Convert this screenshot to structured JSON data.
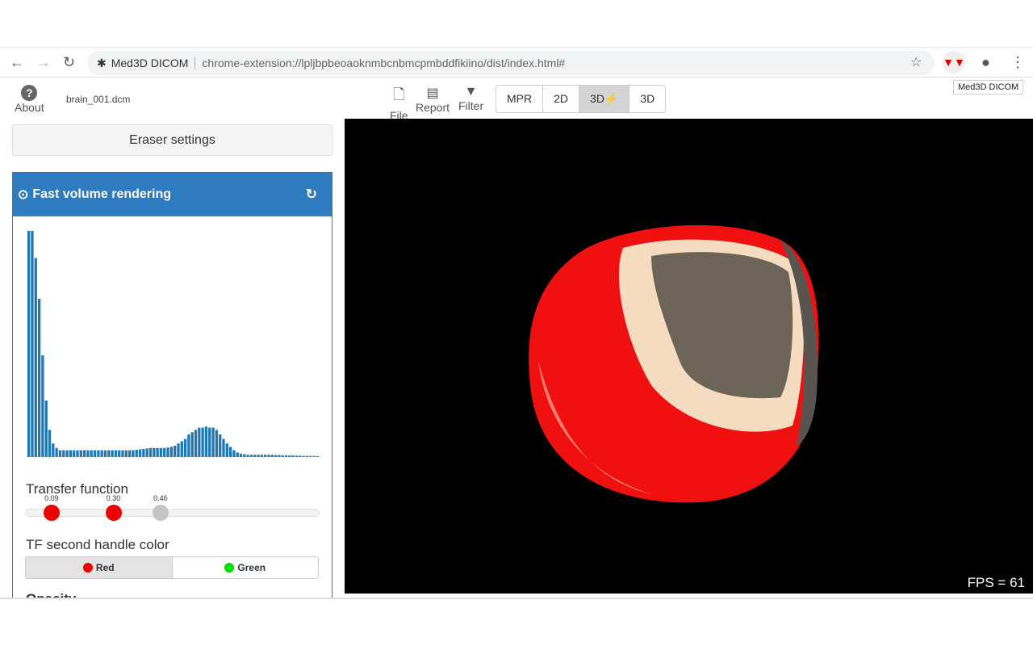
{
  "browser": {
    "site_name": "Med3D DICOM",
    "url": "chrome-extension://lpljbpbeoaoknmbcnbmcpmbddfikiino/dist/index.html#",
    "tooltip": "Med3D DICOM"
  },
  "toolbar": {
    "about": "About",
    "filename": "brain_001.dcm",
    "file": "File",
    "report": "Report",
    "filter": "Filter",
    "modes": [
      "MPR",
      "2D",
      "3D⚡",
      "3D"
    ],
    "active_mode": "3D⚡"
  },
  "sidebar": {
    "eraser": "Eraser settings",
    "panel_title": "Fast volume rendering",
    "transfer_label": "Transfer function",
    "handles": [
      {
        "value": "0.09",
        "color": "#ee0000"
      },
      {
        "value": "0.30",
        "color": "#ee0000"
      },
      {
        "value": "0.46",
        "color": "#c4c4c4"
      }
    ],
    "tf_color_label": "TF second handle color",
    "color_options": [
      {
        "label": "Red",
        "color": "#ee0000",
        "selected": true
      },
      {
        "label": "Green",
        "color": "#00dd00",
        "selected": false
      }
    ],
    "next_section": "Opacity"
  },
  "histogram": {
    "color": "#1f77b4",
    "values": [
      100,
      100,
      88,
      70,
      45,
      25,
      12,
      6,
      4,
      3,
      3,
      3,
      3,
      3,
      3,
      3,
      3,
      3,
      3,
      3,
      3,
      3,
      3,
      3,
      3,
      3,
      3,
      3,
      3,
      3,
      3,
      3.2,
      3.4,
      3.6,
      3.8,
      4,
      4,
      4,
      4,
      4,
      4.2,
      4.5,
      5,
      6,
      7,
      8,
      10,
      11,
      12,
      13,
      13,
      13.5,
      13,
      13,
      12,
      10,
      8,
      6,
      4.5,
      3,
      2,
      1.5,
      1.2,
      1,
      1,
      1,
      1,
      1,
      1,
      1,
      1,
      0.9,
      0.9,
      0.8,
      0.8,
      0.7,
      0.7,
      0.6,
      0.6,
      0.5,
      0.5,
      0.5,
      0.5,
      0.4
    ]
  },
  "viewport": {
    "fps": "FPS = 61"
  }
}
